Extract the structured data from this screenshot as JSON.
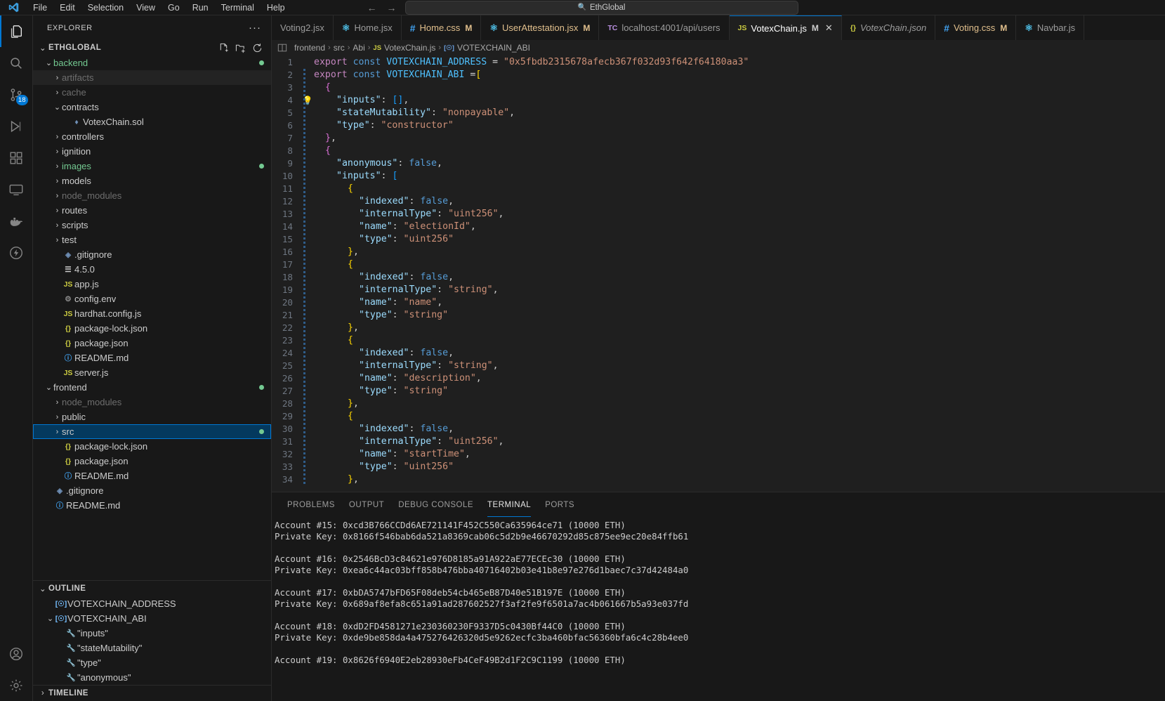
{
  "titlebar": {
    "menus": [
      "File",
      "Edit",
      "Selection",
      "View",
      "Go",
      "Run",
      "Terminal",
      "Help"
    ],
    "back_arrow": "←",
    "forward_arrow": "→",
    "command_center_text": "EthGlobal",
    "command_center_icon": "search-icon"
  },
  "activitybar": {
    "items": [
      {
        "name": "explorer",
        "icon": "files-icon",
        "active": true,
        "badge": ""
      },
      {
        "name": "search",
        "icon": "search-icon",
        "active": false,
        "badge": ""
      },
      {
        "name": "source-control",
        "icon": "source-control-icon",
        "active": false,
        "badge": "18"
      },
      {
        "name": "run-and-debug",
        "icon": "debug-icon",
        "active": false,
        "badge": ""
      },
      {
        "name": "extensions",
        "icon": "extensions-icon",
        "active": false,
        "badge": ""
      },
      {
        "name": "remote-explorer",
        "icon": "remote-icon",
        "active": false,
        "badge": ""
      },
      {
        "name": "docker",
        "icon": "docker-icon",
        "active": false,
        "badge": ""
      },
      {
        "name": "thunder-client",
        "icon": "thunder-icon",
        "active": false,
        "badge": ""
      }
    ],
    "bottom": [
      {
        "name": "accounts",
        "icon": "account-icon"
      },
      {
        "name": "settings",
        "icon": "gear-icon"
      }
    ]
  },
  "sidebar": {
    "title": "EXPLORER",
    "more_actions": "···",
    "root_label": "ETHGLOBAL",
    "root_actions": [
      "new-file-icon",
      "new-folder-icon",
      "refresh-icon"
    ],
    "tree": [
      {
        "label": "backend",
        "depth": 1,
        "type": "folder",
        "open": true,
        "color": "green",
        "dot": "#73c991"
      },
      {
        "label": "artifacts",
        "depth": 2,
        "type": "folder",
        "open": false,
        "color": "dim",
        "hovered": true
      },
      {
        "label": "cache",
        "depth": 2,
        "type": "folder",
        "open": false,
        "color": "dim"
      },
      {
        "label": "contracts",
        "depth": 2,
        "type": "folder",
        "open": true,
        "color": "normal"
      },
      {
        "label": "VotexChain.sol",
        "depth": 3,
        "type": "sol",
        "color": "normal"
      },
      {
        "label": "controllers",
        "depth": 2,
        "type": "folder",
        "open": false,
        "color": "normal"
      },
      {
        "label": "ignition",
        "depth": 2,
        "type": "folder",
        "open": false,
        "color": "normal"
      },
      {
        "label": "images",
        "depth": 2,
        "type": "folder",
        "open": false,
        "color": "green",
        "dot": "#73c991"
      },
      {
        "label": "models",
        "depth": 2,
        "type": "folder",
        "open": false,
        "color": "normal"
      },
      {
        "label": "node_modules",
        "depth": 2,
        "type": "folder",
        "open": false,
        "color": "dim"
      },
      {
        "label": "routes",
        "depth": 2,
        "type": "folder",
        "open": false,
        "color": "normal"
      },
      {
        "label": "scripts",
        "depth": 2,
        "type": "folder",
        "open": false,
        "color": "normal"
      },
      {
        "label": "test",
        "depth": 2,
        "type": "folder",
        "open": false,
        "color": "normal"
      },
      {
        "label": ".gitignore",
        "depth": 2,
        "type": "git",
        "color": "normal"
      },
      {
        "label": "4.5.0",
        "depth": 2,
        "type": "text",
        "color": "normal"
      },
      {
        "label": "app.js",
        "depth": 2,
        "type": "js",
        "color": "normal"
      },
      {
        "label": "config.env",
        "depth": 2,
        "type": "env",
        "color": "normal"
      },
      {
        "label": "hardhat.config.js",
        "depth": 2,
        "type": "js",
        "color": "normal"
      },
      {
        "label": "package-lock.json",
        "depth": 2,
        "type": "json",
        "color": "normal"
      },
      {
        "label": "package.json",
        "depth": 2,
        "type": "json",
        "color": "normal"
      },
      {
        "label": "README.md",
        "depth": 2,
        "type": "md",
        "color": "normal"
      },
      {
        "label": "server.js",
        "depth": 2,
        "type": "js",
        "color": "normal"
      },
      {
        "label": "frontend",
        "depth": 1,
        "type": "folder",
        "open": true,
        "color": "normal",
        "dot": "#73c991"
      },
      {
        "label": "node_modules",
        "depth": 2,
        "type": "folder",
        "open": false,
        "color": "dim"
      },
      {
        "label": "public",
        "depth": 2,
        "type": "folder",
        "open": false,
        "color": "normal"
      },
      {
        "label": "src",
        "depth": 2,
        "type": "folder",
        "open": false,
        "color": "normal",
        "selected": true,
        "dot": "#73c991"
      },
      {
        "label": "package-lock.json",
        "depth": 2,
        "type": "json",
        "color": "normal"
      },
      {
        "label": "package.json",
        "depth": 2,
        "type": "json",
        "color": "normal"
      },
      {
        "label": "README.md",
        "depth": 2,
        "type": "md",
        "color": "normal"
      },
      {
        "label": ".gitignore",
        "depth": 1,
        "type": "git",
        "color": "normal"
      },
      {
        "label": "README.md",
        "depth": 1,
        "type": "md",
        "color": "normal"
      }
    ],
    "outline": {
      "title": "OUTLINE",
      "items": [
        {
          "label": "VOTEXCHAIN_ADDRESS",
          "depth": 1,
          "kind": "variable",
          "open": null
        },
        {
          "label": "VOTEXCHAIN_ABI",
          "depth": 1,
          "kind": "variable",
          "open": true
        },
        {
          "label": "\"inputs\"",
          "depth": 2,
          "kind": "property"
        },
        {
          "label": "\"stateMutability\"",
          "depth": 2,
          "kind": "property"
        },
        {
          "label": "\"type\"",
          "depth": 2,
          "kind": "property"
        },
        {
          "label": "\"anonymous\"",
          "depth": 2,
          "kind": "property"
        }
      ]
    },
    "timeline": {
      "title": "TIMELINE"
    }
  },
  "tabs": [
    {
      "label": "Voting2.jsx",
      "icon": "",
      "icon_type": "none",
      "modified": false,
      "active": false,
      "preview": false,
      "close": false
    },
    {
      "label": "Home.jsx",
      "icon": "⚛",
      "icon_type": "react",
      "modified": false,
      "active": false,
      "preview": false,
      "close": false
    },
    {
      "label": "Home.css",
      "icon": "#",
      "icon_type": "css",
      "modified": true,
      "active": false,
      "preview": false,
      "close": false
    },
    {
      "label": "UserAttestation.jsx",
      "icon": "⚛",
      "icon_type": "react",
      "modified": true,
      "active": false,
      "preview": false,
      "close": false
    },
    {
      "label": "localhost:4001/api/users",
      "icon": "TC",
      "icon_type": "thunder",
      "modified": false,
      "active": false,
      "preview": false,
      "close": false
    },
    {
      "label": "VotexChain.js",
      "icon": "JS",
      "icon_type": "js",
      "modified": true,
      "active": true,
      "preview": false,
      "close": true
    },
    {
      "label": "VotexChain.json",
      "icon": "{}",
      "icon_type": "json",
      "modified": false,
      "active": false,
      "preview": true,
      "close": false
    },
    {
      "label": "Voting.css",
      "icon": "#",
      "icon_type": "css",
      "modified": true,
      "active": false,
      "preview": false,
      "close": false
    },
    {
      "label": "Navbar.js",
      "icon": "⚛",
      "icon_type": "react",
      "modified": false,
      "active": false,
      "preview": false,
      "close": false
    }
  ],
  "breadcrumbs": {
    "parts": [
      "frontend",
      "src",
      "Abi",
      "VotexChain.js",
      "VOTEXCHAIN_ABI"
    ],
    "separator": "›",
    "file_icon": "JS",
    "symbol_icon": "[☉]"
  },
  "editor": {
    "filename": "VotexChain.js",
    "contract_address": "0x5fbdb2315678afecb367f032d93f642f64180aa3",
    "code_lines": [
      {
        "n": 1,
        "bulb": false,
        "indent": 0,
        "html": "<span class='t-kw2'>export</span> <span class='t-kw'>const</span> <span class='t-var'>VOTEXCHAIN_ADDRESS</span> <span class='t-op'>=</span> <span class='t-str'>\"0x5fbdb2315678afecb367f032d93f642f64180aa3\"</span>"
      },
      {
        "n": 2,
        "bulb": false,
        "indent": 0,
        "html": "<span class='t-kw2'>export</span> <span class='t-kw'>const</span> <span class='t-var'>VOTEXCHAIN_ABI</span> <span class='t-op'>=</span><span class='t-brk-y'>[</span>"
      },
      {
        "n": 3,
        "bulb": false,
        "indent": 1,
        "html": "<span class='t-brk-p'>{</span>"
      },
      {
        "n": 4,
        "bulb": true,
        "indent": 2,
        "html": "<span class='t-key'>\"inputs\"</span><span class='t-punc'>:</span> <span class='t-brk-b'>[]</span><span class='t-punc'>,</span>"
      },
      {
        "n": 5,
        "bulb": false,
        "indent": 2,
        "html": "<span class='t-key'>\"stateMutability\"</span><span class='t-punc'>:</span> <span class='t-str'>\"nonpayable\"</span><span class='t-punc'>,</span>"
      },
      {
        "n": 6,
        "bulb": false,
        "indent": 2,
        "html": "<span class='t-key'>\"type\"</span><span class='t-punc'>:</span> <span class='t-str'>\"constructor\"</span>"
      },
      {
        "n": 7,
        "bulb": false,
        "indent": 1,
        "html": "<span class='t-brk-p'>}</span><span class='t-punc'>,</span>"
      },
      {
        "n": 8,
        "bulb": false,
        "indent": 1,
        "html": "<span class='t-brk-p'>{</span>"
      },
      {
        "n": 9,
        "bulb": false,
        "indent": 2,
        "html": "<span class='t-key'>\"anonymous\"</span><span class='t-punc'>:</span> <span class='t-kw'>false</span><span class='t-punc'>,</span>"
      },
      {
        "n": 10,
        "bulb": false,
        "indent": 2,
        "html": "<span class='t-key'>\"inputs\"</span><span class='t-punc'>:</span> <span class='t-brk-b'>[</span>"
      },
      {
        "n": 11,
        "bulb": false,
        "indent": 3,
        "html": "<span class='t-brk-y'>{</span>"
      },
      {
        "n": 12,
        "bulb": false,
        "indent": 4,
        "html": "<span class='t-key'>\"indexed\"</span><span class='t-punc'>:</span> <span class='t-kw'>false</span><span class='t-punc'>,</span>"
      },
      {
        "n": 13,
        "bulb": false,
        "indent": 4,
        "html": "<span class='t-key'>\"internalType\"</span><span class='t-punc'>:</span> <span class='t-str'>\"uint256\"</span><span class='t-punc'>,</span>"
      },
      {
        "n": 14,
        "bulb": false,
        "indent": 4,
        "html": "<span class='t-key'>\"name\"</span><span class='t-punc'>:</span> <span class='t-str'>\"electionId\"</span><span class='t-punc'>,</span>"
      },
      {
        "n": 15,
        "bulb": false,
        "indent": 4,
        "html": "<span class='t-key'>\"type\"</span><span class='t-punc'>:</span> <span class='t-str'>\"uint256\"</span>"
      },
      {
        "n": 16,
        "bulb": false,
        "indent": 3,
        "html": "<span class='t-brk-y'>}</span><span class='t-punc'>,</span>"
      },
      {
        "n": 17,
        "bulb": false,
        "indent": 3,
        "html": "<span class='t-brk-y'>{</span>"
      },
      {
        "n": 18,
        "bulb": false,
        "indent": 4,
        "html": "<span class='t-key'>\"indexed\"</span><span class='t-punc'>:</span> <span class='t-kw'>false</span><span class='t-punc'>,</span>"
      },
      {
        "n": 19,
        "bulb": false,
        "indent": 4,
        "html": "<span class='t-key'>\"internalType\"</span><span class='t-punc'>:</span> <span class='t-str'>\"string\"</span><span class='t-punc'>,</span>"
      },
      {
        "n": 20,
        "bulb": false,
        "indent": 4,
        "html": "<span class='t-key'>\"name\"</span><span class='t-punc'>:</span> <span class='t-str'>\"name\"</span><span class='t-punc'>,</span>"
      },
      {
        "n": 21,
        "bulb": false,
        "indent": 4,
        "html": "<span class='t-key'>\"type\"</span><span class='t-punc'>:</span> <span class='t-str'>\"string\"</span>"
      },
      {
        "n": 22,
        "bulb": false,
        "indent": 3,
        "html": "<span class='t-brk-y'>}</span><span class='t-punc'>,</span>"
      },
      {
        "n": 23,
        "bulb": false,
        "indent": 3,
        "html": "<span class='t-brk-y'>{</span>"
      },
      {
        "n": 24,
        "bulb": false,
        "indent": 4,
        "html": "<span class='t-key'>\"indexed\"</span><span class='t-punc'>:</span> <span class='t-kw'>false</span><span class='t-punc'>,</span>"
      },
      {
        "n": 25,
        "bulb": false,
        "indent": 4,
        "html": "<span class='t-key'>\"internalType\"</span><span class='t-punc'>:</span> <span class='t-str'>\"string\"</span><span class='t-punc'>,</span>"
      },
      {
        "n": 26,
        "bulb": false,
        "indent": 4,
        "html": "<span class='t-key'>\"name\"</span><span class='t-punc'>:</span> <span class='t-str'>\"description\"</span><span class='t-punc'>,</span>"
      },
      {
        "n": 27,
        "bulb": false,
        "indent": 4,
        "html": "<span class='t-key'>\"type\"</span><span class='t-punc'>:</span> <span class='t-str'>\"string\"</span>"
      },
      {
        "n": 28,
        "bulb": false,
        "indent": 3,
        "html": "<span class='t-brk-y'>}</span><span class='t-punc'>,</span>"
      },
      {
        "n": 29,
        "bulb": false,
        "indent": 3,
        "html": "<span class='t-brk-y'>{</span>"
      },
      {
        "n": 30,
        "bulb": false,
        "indent": 4,
        "html": "<span class='t-key'>\"indexed\"</span><span class='t-punc'>:</span> <span class='t-kw'>false</span><span class='t-punc'>,</span>"
      },
      {
        "n": 31,
        "bulb": false,
        "indent": 4,
        "html": "<span class='t-key'>\"internalType\"</span><span class='t-punc'>:</span> <span class='t-str'>\"uint256\"</span><span class='t-punc'>,</span>"
      },
      {
        "n": 32,
        "bulb": false,
        "indent": 4,
        "html": "<span class='t-key'>\"name\"</span><span class='t-punc'>:</span> <span class='t-str'>\"startTime\"</span><span class='t-punc'>,</span>"
      },
      {
        "n": 33,
        "bulb": false,
        "indent": 4,
        "html": "<span class='t-key'>\"type\"</span><span class='t-punc'>:</span> <span class='t-str'>\"uint256\"</span>"
      },
      {
        "n": 34,
        "bulb": false,
        "indent": 3,
        "html": "<span class='t-brk-y'>}</span><span class='t-punc'>,</span>"
      }
    ]
  },
  "panel": {
    "tabs": [
      {
        "label": "PROBLEMS",
        "active": false
      },
      {
        "label": "OUTPUT",
        "active": false
      },
      {
        "label": "DEBUG CONSOLE",
        "active": false
      },
      {
        "label": "TERMINAL",
        "active": true
      },
      {
        "label": "PORTS",
        "active": false
      }
    ],
    "terminal_lines": [
      "Account #15: 0xcd3B766CCDd6AE721141F452C550Ca635964ce71 (10000 ETH)",
      "Private Key: 0x8166f546bab6da521a8369cab06c5d2b9e46670292d85c875ee9ec20e84ffb61",
      "",
      "Account #16: 0x2546BcD3c84621e976D8185a91A922aE77ECEc30 (10000 ETH)",
      "Private Key: 0xea6c44ac03bff858b476bba40716402b03e41b8e97e276d1baec7c37d42484a0",
      "",
      "Account #17: 0xbDA5747bFD65F08deb54cb465eB87D40e51B197E (10000 ETH)",
      "Private Key: 0x689af8efa8c651a91ad287602527f3af2fe9f6501a7ac4b061667b5a93e037fd",
      "",
      "Account #18: 0xdD2FD4581271e230360230F9337D5c0430Bf44C0 (10000 ETH)",
      "Private Key: 0xde9be858da4a475276426320d5e9262ecfc3ba460bfac56360bfa6c4c28b4ee0",
      "",
      "Account #19: 0x8626f6940E2eb28930eFb4CeF49B2d1F2C9C1199 (10000 ETH)"
    ]
  },
  "colors": {
    "accent": "#0078d4",
    "modified_git": "#73c991",
    "tab_modified_text": "#e2c08d",
    "string": "#ce9178",
    "keyword": "#569cd6",
    "property": "#9cdcfe"
  }
}
